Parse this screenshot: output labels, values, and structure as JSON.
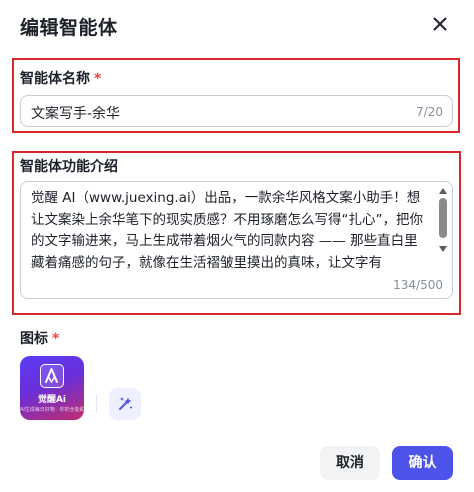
{
  "dialog": {
    "title": "编辑智能体"
  },
  "fields": {
    "name": {
      "label": "智能体名称",
      "required_mark": "*",
      "value": "文案写手-余华",
      "counter": "7/20"
    },
    "description": {
      "label": "智能体功能介绍",
      "value": "觉醒 AI（www.juexing.ai）出品，一款余华风格文案小助手！想让文案染上余华笔下的现实质感？不用琢磨怎么写得“扎心”，把你的文字输进来，马上生成带着烟火气的同款内容 —— 那些直白里藏着痛感的句子，就像在生活褶皱里摸出的真味，让文字有",
      "counter": "134/500"
    },
    "icon": {
      "label": "图标",
      "required_mark": "*",
      "app_icon": {
        "brand": "觉醒Ai",
        "tagline": "AI生成每日好物 · 你的全能助手"
      },
      "ai_generate_icon": "magic-sparkle-icon"
    }
  },
  "buttons": {
    "cancel": "取消",
    "confirm": "确认"
  },
  "colors": {
    "primary": "#4d53e8",
    "highlight_border": "#d9272e",
    "required": "#f53f3f"
  }
}
